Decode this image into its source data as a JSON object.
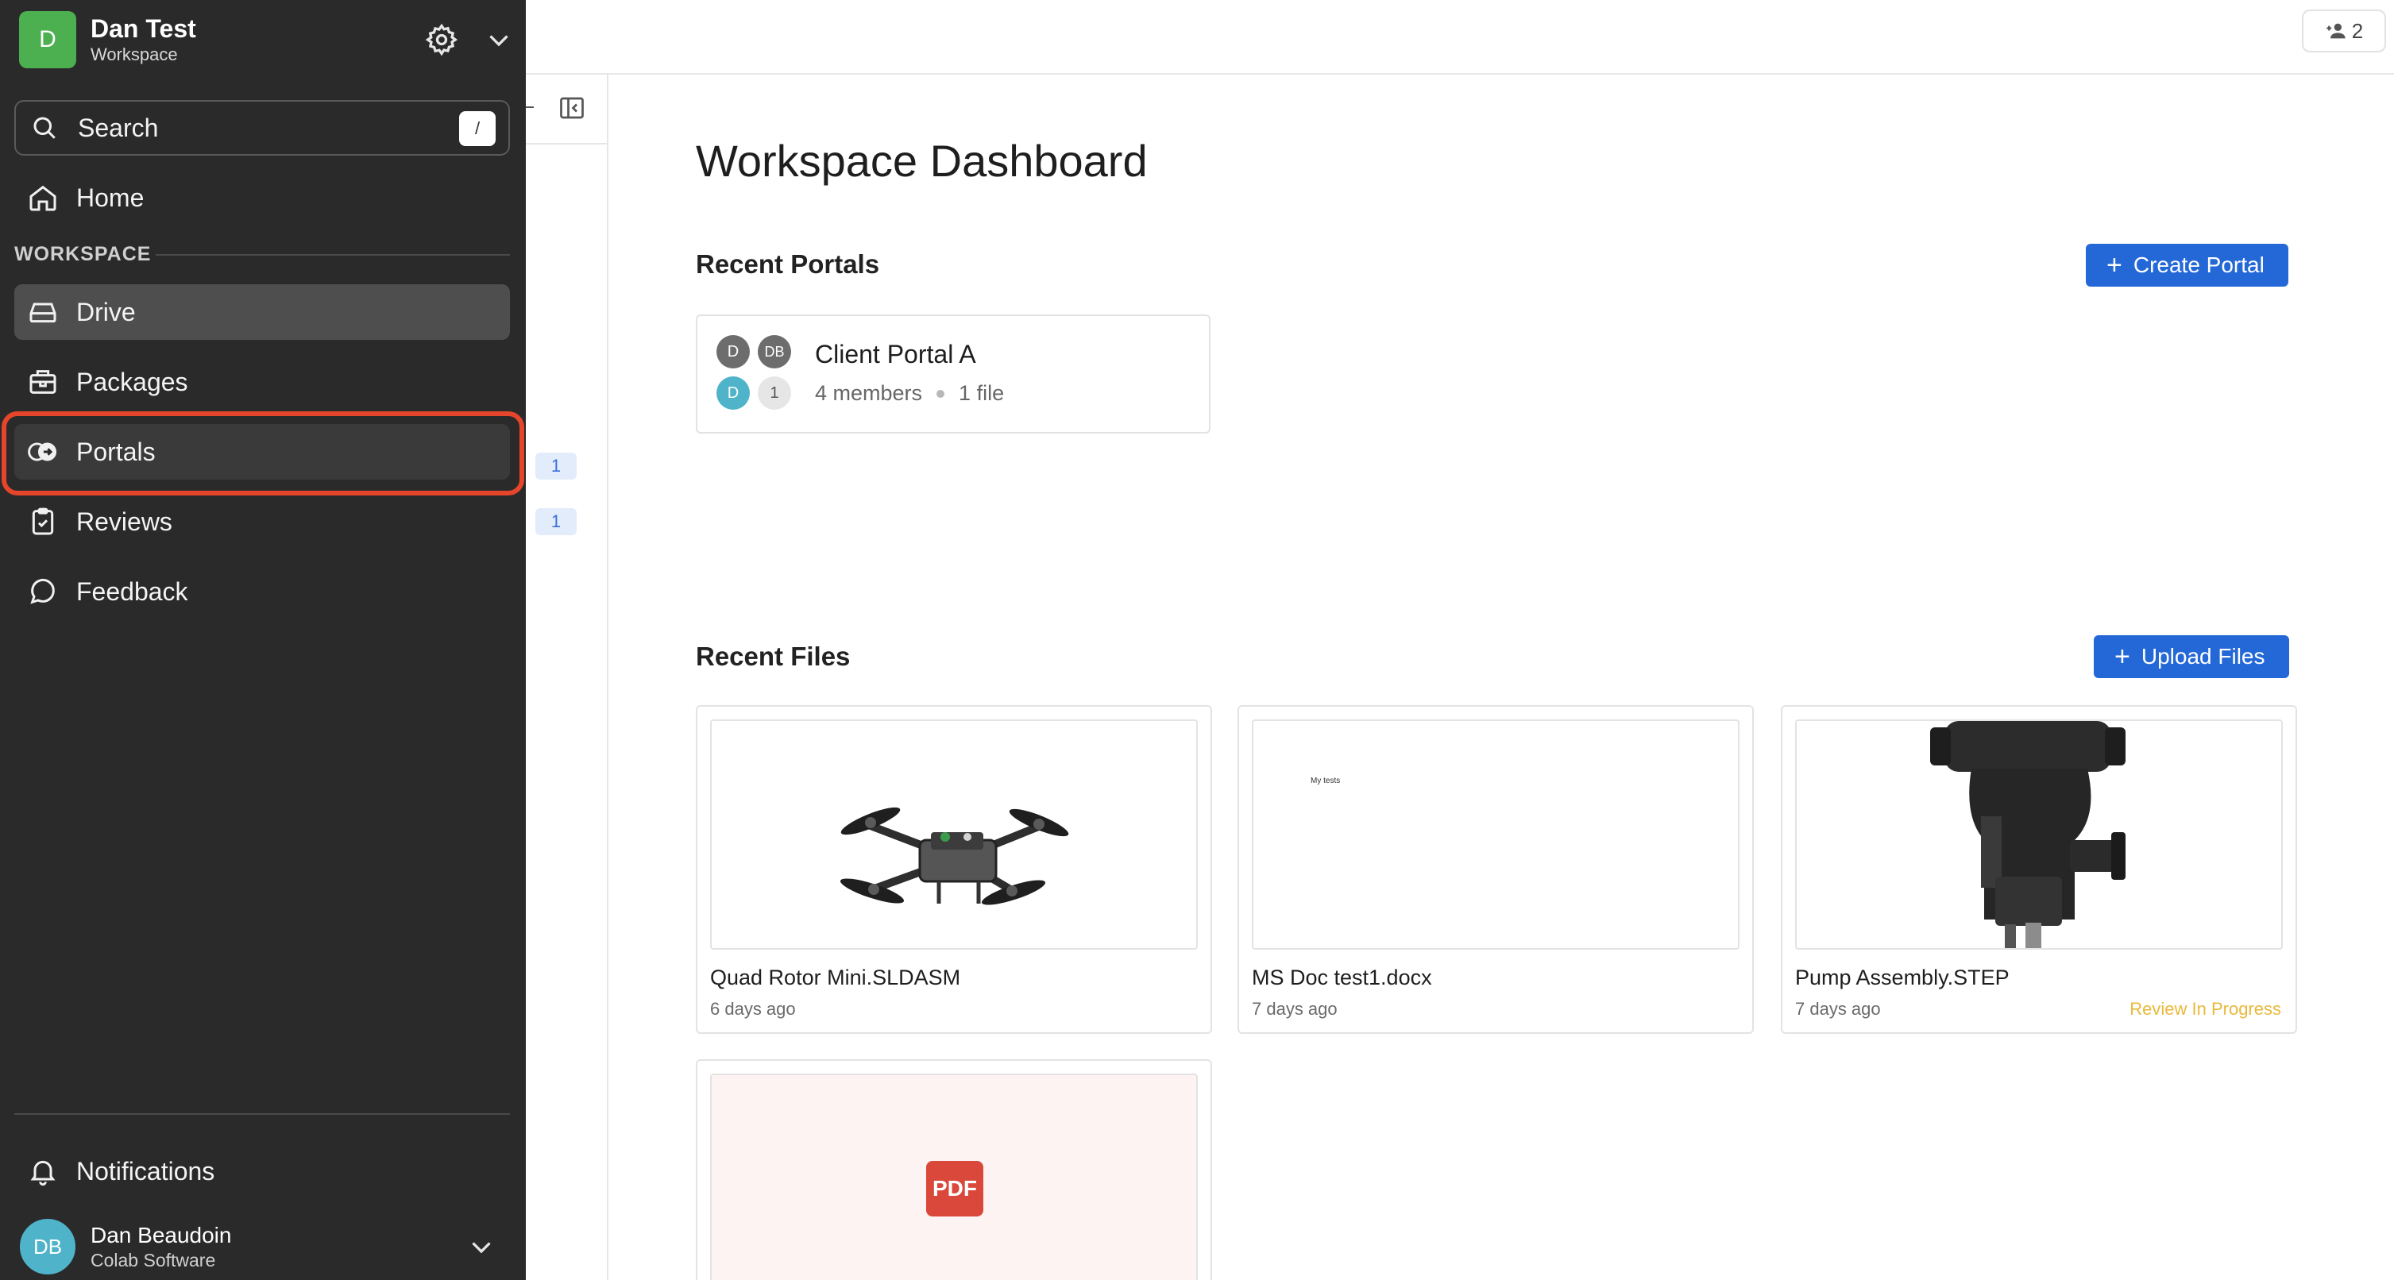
{
  "workspace": {
    "initial": "D",
    "name": "Dan Test",
    "type": "Workspace"
  },
  "search": {
    "label": "Search",
    "shortcut": "/"
  },
  "sidebar": {
    "home": "Home",
    "section_label": "WORKSPACE",
    "items": [
      {
        "label": "Drive",
        "icon": "drive-icon",
        "active": true
      },
      {
        "label": "Packages",
        "icon": "package-icon"
      },
      {
        "label": "Portals",
        "icon": "portal-icon",
        "highlighted": true
      },
      {
        "label": "Reviews",
        "icon": "review-clipboard-icon"
      },
      {
        "label": "Feedback",
        "icon": "chat-bubble-icon"
      }
    ],
    "notifications": "Notifications"
  },
  "user": {
    "initials": "DB",
    "name": "Dan Beaudoin",
    "org": "Colab Software"
  },
  "middle": {
    "badges": [
      "1",
      "1"
    ]
  },
  "topbar": {
    "member_count": "2"
  },
  "main": {
    "title": "Workspace Dashboard",
    "recent_portals_title": "Recent Portals",
    "create_portal": "Create Portal",
    "portal": {
      "name": "Client Portal A",
      "members": "4 members",
      "files": "1 file",
      "avatars": [
        "D",
        "DB",
        "D",
        "1"
      ]
    },
    "recent_files_title": "Recent Files",
    "upload_files": "Upload Files",
    "files": [
      {
        "name": "Quad Rotor Mini.SLDASM",
        "date": "6 days ago",
        "status": ""
      },
      {
        "name": "MS Doc test1.docx",
        "date": "7 days ago",
        "status": "",
        "preview_text": "My tests"
      },
      {
        "name": "Pump Assembly.STEP",
        "date": "7 days ago",
        "status": "Review In Progress"
      },
      {
        "name": "",
        "date": "",
        "status": "",
        "badge": "PDF"
      }
    ]
  },
  "colors": {
    "accent": "#2468d8",
    "sidebar_bg": "#2a2a2a",
    "highlight": "#e5452a",
    "status_review": "#e8b93a"
  }
}
